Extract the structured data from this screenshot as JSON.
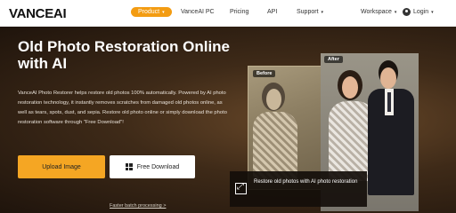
{
  "nav": {
    "logo_main": "VANCE",
    "logo_ai": "AI",
    "items": [
      {
        "label": "Product",
        "has_caret": true
      },
      {
        "label": "VanceAI PC",
        "has_caret": false
      },
      {
        "label": "Pricing",
        "has_caret": false
      },
      {
        "label": "API",
        "has_caret": false
      },
      {
        "label": "Support",
        "has_caret": true
      },
      {
        "label": "Workspace",
        "has_caret": true
      }
    ],
    "login": "Login",
    "caret": "▾",
    "active_color": "#f39c12"
  },
  "hero": {
    "title": "Old Photo Restoration Online with AI",
    "description": "VanceAI Photo Restorer helps restore old photos 100% automatically. Powered by AI photo restoration technology, it instantly removes scratches from damaged old photos online, as well as tears, spots, dust, and sepia. Restore old photo online or simply download the photo restoration software through \"Free Download\"!",
    "upload_button": "Upload Image",
    "free_download_button": "Free Download",
    "batch_link": "Faster batch processing >",
    "upload_color": "#f5a623"
  },
  "showcase": {
    "before_label": "Before",
    "after_label": "After",
    "caption": "Restore old photos with AI photo restoration"
  },
  "icons": {
    "windows": "windows-icon",
    "user": "user-icon",
    "expand": "expand-icon"
  }
}
